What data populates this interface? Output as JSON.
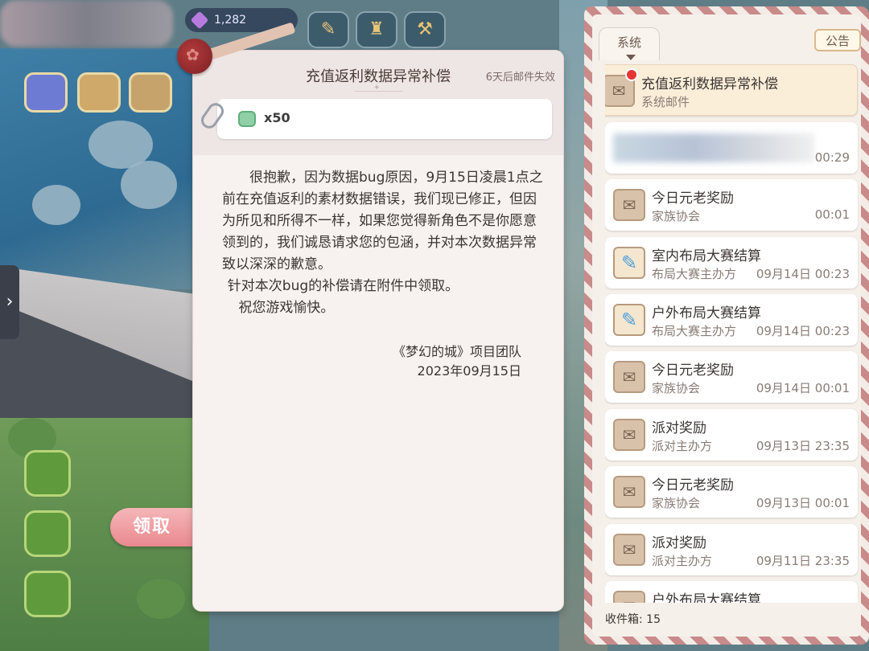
{
  "hud": {
    "gems": "1,282"
  },
  "letter": {
    "title": "充值返利数据异常补偿",
    "expire": "6天后邮件失效",
    "attachment": {
      "icon": "currency-icon",
      "quantity": "x50"
    },
    "paragraphs": [
      "很抱歉，因为数据bug原因，9月15日凌晨1点之前在充值返利的素材数据错误，我们现已修正，但因为所见和所得不一样，如果您觉得新角色不是你愿意领到的，我们诚恳请求您的包涵，并对本次数据异常致以深深的歉意。",
      "针对本次bug的补偿请在附件中领取。",
      "祝您游戏愉快。"
    ],
    "signature_team": "《梦幻的城》项目团队",
    "signature_date": "2023年09月15日",
    "claim_label": "领取"
  },
  "mailbox": {
    "tab_label": "系统",
    "notice_label": "公告",
    "inbox_count_label": "收件箱: 15",
    "items": [
      {
        "title": "充值返利数据异常补偿",
        "sender": "系统邮件",
        "time": "",
        "icon": "envelope-icon",
        "selected": true,
        "unread": true
      },
      {
        "title": "",
        "sender": "",
        "time": "00:29",
        "icon": "",
        "blurred": true
      },
      {
        "title": "今日元老奖励",
        "sender": "家族协会",
        "time": "00:01",
        "icon": "envelope-icon"
      },
      {
        "title": "室内布局大赛结算",
        "sender": "布局大赛主办方",
        "time": "09月14日 00:23",
        "icon": "pencil-icon"
      },
      {
        "title": "户外布局大赛结算",
        "sender": "布局大赛主办方",
        "time": "09月14日 00:23",
        "icon": "pencil-icon"
      },
      {
        "title": "今日元老奖励",
        "sender": "家族协会",
        "time": "09月14日 00:01",
        "icon": "envelope-icon"
      },
      {
        "title": "派对奖励",
        "sender": "派对主办方",
        "time": "09月13日 23:35",
        "icon": "envelope-icon"
      },
      {
        "title": "今日元老奖励",
        "sender": "家族协会",
        "time": "09月13日 00:01",
        "icon": "envelope-icon"
      },
      {
        "title": "派对奖励",
        "sender": "派对主办方",
        "time": "09月11日 23:35",
        "icon": "envelope-icon"
      },
      {
        "title": "户外布局大赛结算",
        "sender": "",
        "time": "",
        "icon": "envelope-icon",
        "partial": true
      }
    ]
  }
}
